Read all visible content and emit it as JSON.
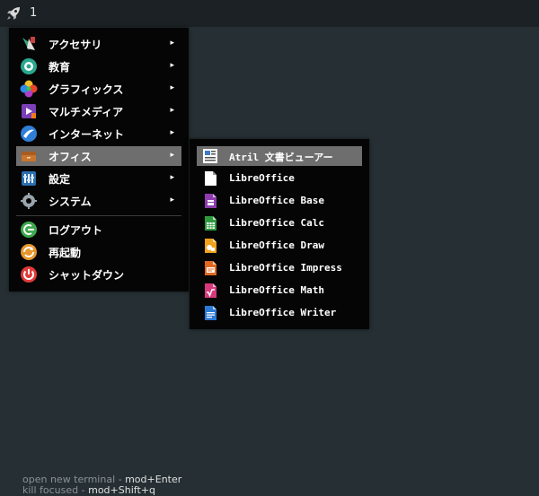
{
  "topbar": {
    "launcher_icon": "rocket-icon",
    "workspace": "1"
  },
  "main_menu": {
    "items": [
      {
        "label": "アクセサリ",
        "icon": "accessories-icon",
        "has_submenu": true
      },
      {
        "label": "教育",
        "icon": "education-icon",
        "has_submenu": true
      },
      {
        "label": "グラフィックス",
        "icon": "graphics-icon",
        "has_submenu": true
      },
      {
        "label": "マルチメディア",
        "icon": "multimedia-icon",
        "has_submenu": true
      },
      {
        "label": "インターネット",
        "icon": "internet-icon",
        "has_submenu": true
      },
      {
        "label": "オフィス",
        "icon": "office-icon",
        "has_submenu": true,
        "active": true
      },
      {
        "label": "設定",
        "icon": "settings-icon",
        "has_submenu": true
      },
      {
        "label": "システム",
        "icon": "system-icon",
        "has_submenu": true
      },
      {
        "label": "ログアウト",
        "icon": "logout-icon",
        "has_submenu": false
      },
      {
        "label": "再起動",
        "icon": "reboot-icon",
        "has_submenu": false
      },
      {
        "label": "シャットダウン",
        "icon": "shutdown-icon",
        "has_submenu": false
      }
    ],
    "arrow": "▸"
  },
  "office_menu": {
    "items": [
      {
        "label": "Atril 文書ビューアー",
        "icon": "document-viewer-icon",
        "active": true
      },
      {
        "label": "LibreOffice",
        "icon": "libreoffice-icon"
      },
      {
        "label": "LibreOffice Base",
        "icon": "libreoffice-base-icon"
      },
      {
        "label": "LibreOffice Calc",
        "icon": "libreoffice-calc-icon"
      },
      {
        "label": "LibreOffice Draw",
        "icon": "libreoffice-draw-icon"
      },
      {
        "label": "LibreOffice Impress",
        "icon": "libreoffice-impress-icon"
      },
      {
        "label": "LibreOffice Math",
        "icon": "libreoffice-math-icon"
      },
      {
        "label": "LibreOffice Writer",
        "icon": "libreoffice-writer-icon"
      }
    ]
  },
  "hints": [
    {
      "text": "open new terminal - ",
      "key": "mod+Enter"
    },
    {
      "text": "kill focused - ",
      "key": "mod+Shift+q"
    }
  ],
  "colors": {
    "desktop": "#263034",
    "topbar": "#1b2124",
    "menu_bg": "#050505",
    "highlight": "#6e6e6e"
  }
}
